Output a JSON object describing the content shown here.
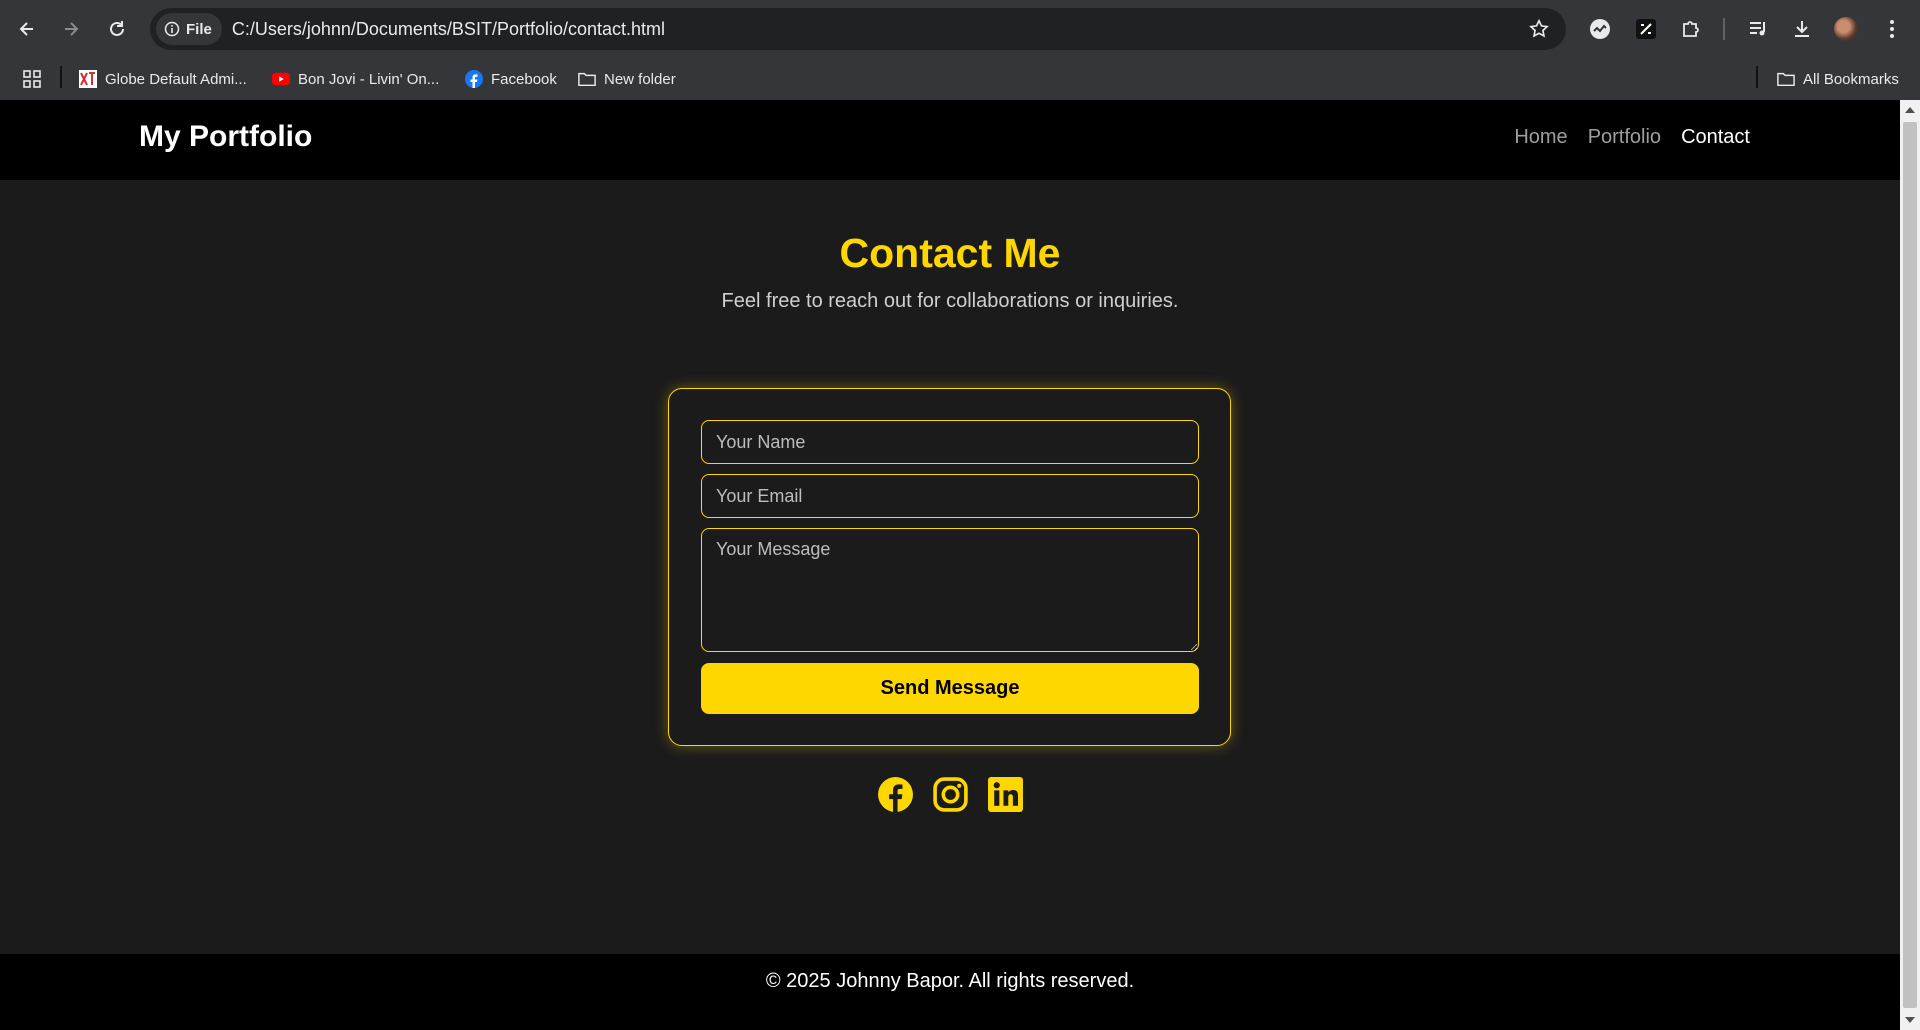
{
  "browser": {
    "file_chip_label": "File",
    "url": "C:/Users/johnn/Documents/BSIT/Portfolio/contact.html",
    "bookmarks": [
      {
        "label": "Globe Default Admi...",
        "icon": "globe-favicon"
      },
      {
        "label": "Bon Jovi - Livin' On...",
        "icon": "youtube-favicon"
      },
      {
        "label": "Facebook",
        "icon": "facebook-favicon"
      },
      {
        "label": "New folder",
        "icon": "folder-icon"
      }
    ],
    "all_bookmarks_label": "All Bookmarks"
  },
  "site": {
    "logo": "My Portfolio",
    "nav": [
      {
        "label": "Home",
        "active": false
      },
      {
        "label": "Portfolio",
        "active": false
      },
      {
        "label": "Contact",
        "active": true
      }
    ]
  },
  "contact": {
    "title": "Contact Me",
    "subtitle": "Feel free to reach out for collaborations or inquiries.",
    "name_placeholder": "Your Name",
    "email_placeholder": "Your Email",
    "message_placeholder": "Your Message",
    "name_value": "",
    "email_value": "",
    "message_value": "",
    "send_label": "Send Message"
  },
  "socials": [
    {
      "icon": "facebook-icon"
    },
    {
      "icon": "instagram-icon"
    },
    {
      "icon": "linkedin-icon"
    }
  ],
  "footer": {
    "text": "© 2025 Johnny Bapor. All rights reserved."
  },
  "colors": {
    "accent": "#ffd700",
    "page_bg": "#1b1b1b",
    "header_bg": "#000000",
    "chrome_bg": "#35363a"
  }
}
